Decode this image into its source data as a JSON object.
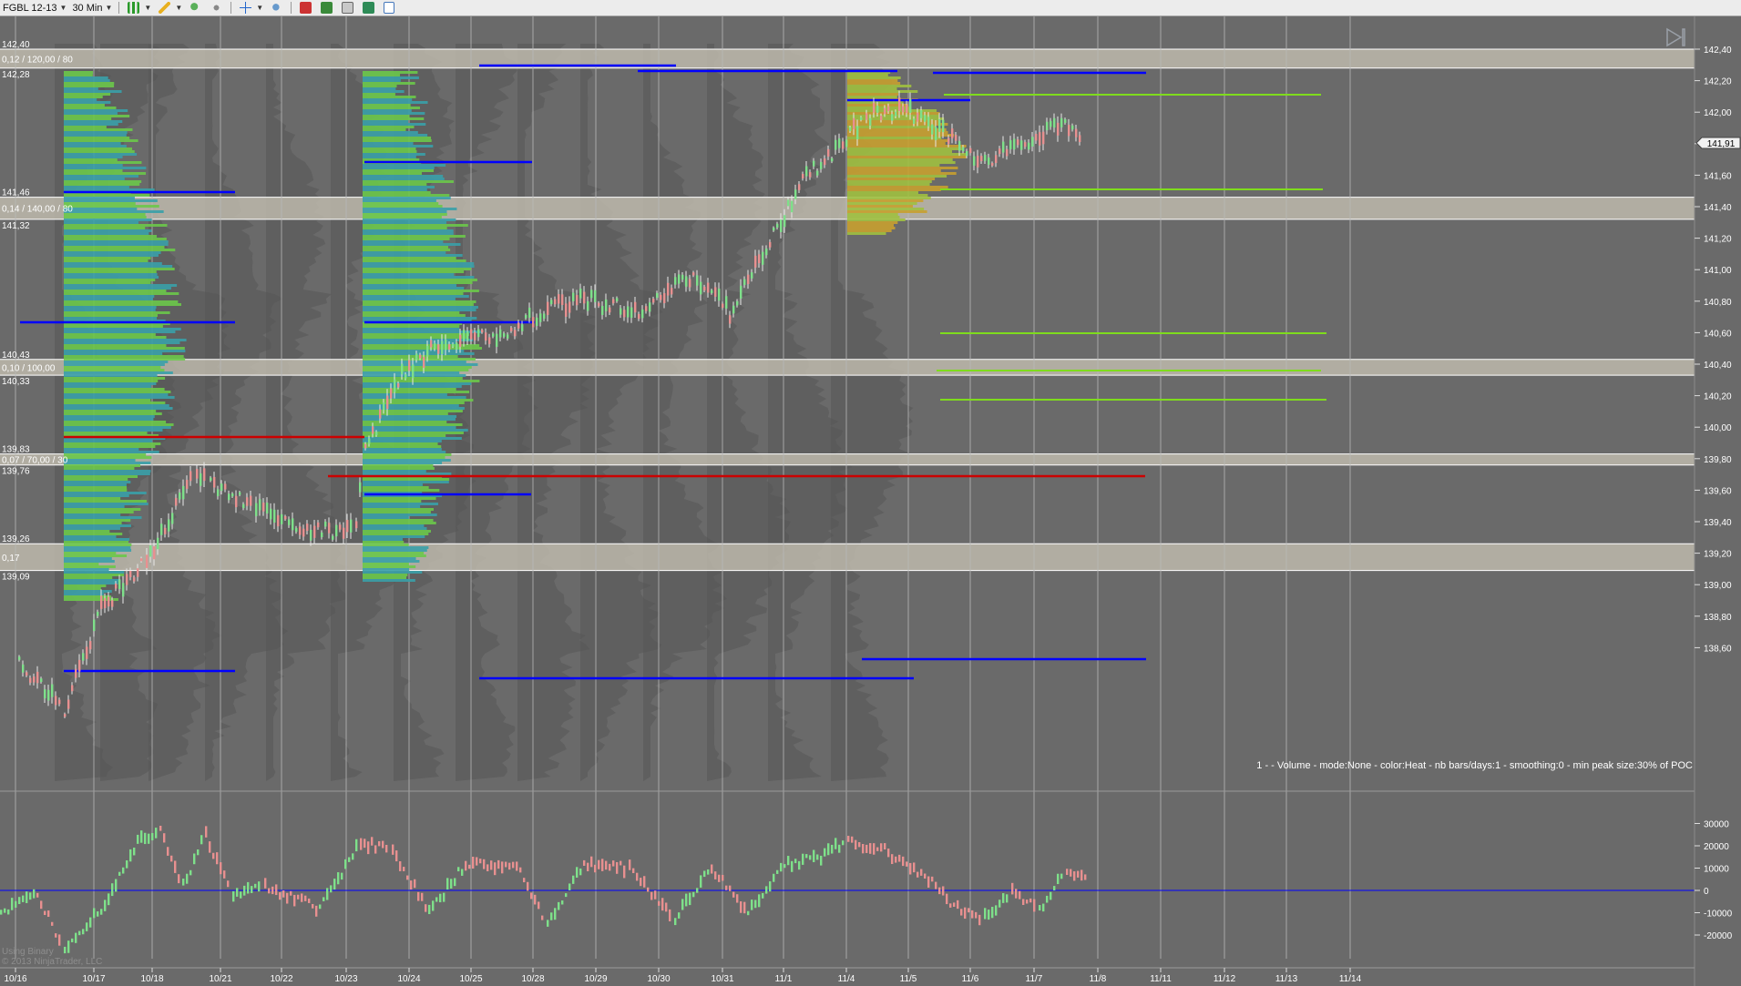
{
  "toolbar": {
    "instrument": "FGBL 12-13",
    "interval": "30 Min",
    "icons": [
      "bar-type-icon",
      "drawing-pencil-icon",
      "zoom-icon",
      "crosshair-icon",
      "properties-icon",
      "indicators-icon",
      "strategy-icon",
      "data-box-icon",
      "template-icon",
      "order-panel-icon"
    ]
  },
  "price_axis": {
    "labels": [
      "142,40",
      "142,20",
      "142,00",
      "141,80",
      "141,60",
      "141,40",
      "141,20",
      "141,00",
      "140,80",
      "140,60",
      "140,40",
      "140,20",
      "140,00",
      "139,80",
      "139,60",
      "139,40",
      "139,20",
      "139,00",
      "138,80",
      "138,60"
    ],
    "last_price": "141,91"
  },
  "osc_axis": {
    "labels": [
      "30000",
      "20000",
      "10000",
      "0",
      "-10000",
      "-20000"
    ]
  },
  "date_labels": [
    "10/16",
    "10/17",
    "10/18",
    "10/21",
    "10/22",
    "10/23",
    "10/24",
    "10/25",
    "10/28",
    "10/29",
    "10/30",
    "10/31",
    "11/1",
    "11/4",
    "11/5",
    "11/6",
    "11/7",
    "11/8",
    "11/11",
    "11/12",
    "11/13",
    "11/14"
  ],
  "zones": [
    {
      "top": "142,40",
      "bottom": "142,28",
      "text": "0,12 / 120,00 / 80"
    },
    {
      "top": "141,46",
      "bottom": "141,32",
      "text": "0,14 / 140,00 / 80"
    },
    {
      "top": "140,43",
      "bottom": "140,33",
      "text": "0,10 / 100,00"
    },
    {
      "top": "139,83",
      "bottom": "139,76",
      "text": "0,07 / 70,00 / 30"
    },
    {
      "top": "139,26",
      "bottom": "139,09",
      "text": "0,17"
    }
  ],
  "indicator_note": "1 -   - Volume - mode:None - color:Heat - nb bars/days:1 - smoothing:0 - min peak size:30% of POC",
  "watermark": {
    "line1": "Using Binary",
    "line2": "© 2013 NinjaTrader, LLC"
  },
  "colors": {
    "background": "#6a6a6a",
    "zone": "#c9c4b6",
    "poc_blue": "#0000ff",
    "poc_red": "#cc0000",
    "level_green": "#7fdc1c",
    "up_candle": "#7ee08a",
    "down_candle": "#e89090"
  }
}
